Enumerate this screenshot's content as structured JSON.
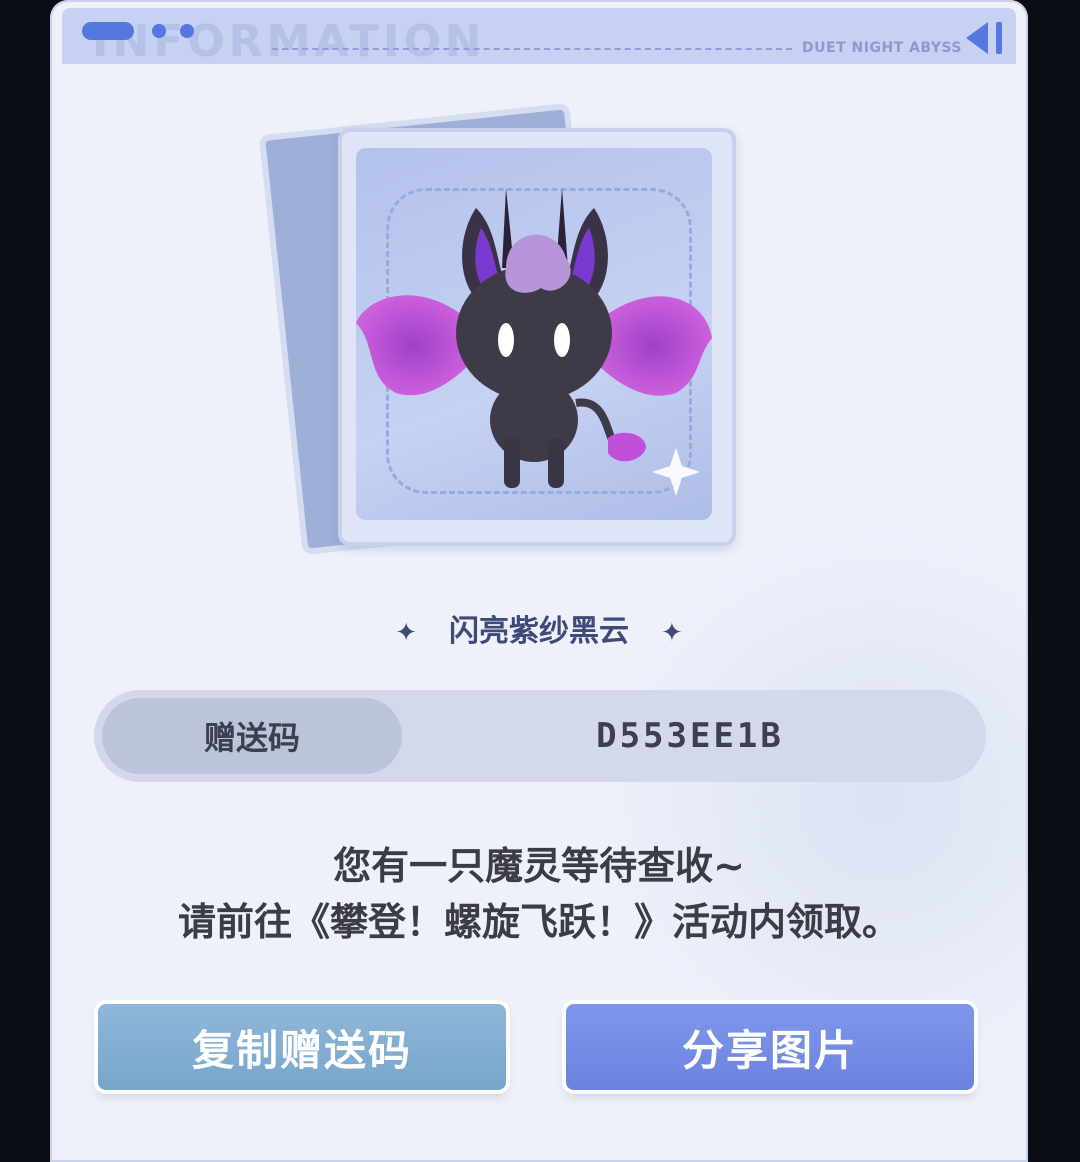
{
  "header": {
    "watermark": "INFORMATION",
    "brand": "DUET NIGHT ABYSS"
  },
  "item": {
    "name": "闪亮紫纱黑云",
    "star_left": "✦",
    "star_right": "✦"
  },
  "gift_code": {
    "label": "赠送码",
    "value": "D553EE1B"
  },
  "message": {
    "line1": "您有一只魔灵等待查收~",
    "line2": "请前往《攀登！螺旋飞跃！》活动内领取。"
  },
  "buttons": {
    "copy_label": "复制赠送码",
    "share_label": "分享图片"
  },
  "colors": {
    "accent_blue": "#5577e0",
    "copy_button": "#78a5cc",
    "share_button": "#6b83df",
    "panel_bg": "#eef1fa"
  }
}
